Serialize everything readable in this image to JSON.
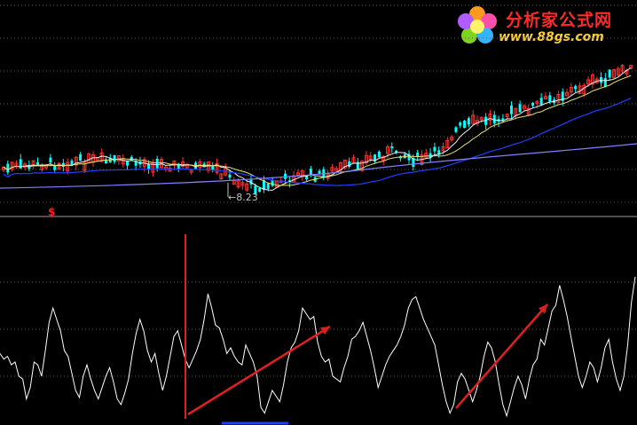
{
  "logo": {
    "title": "分析家公式网",
    "url": "www.88gs.com"
  },
  "chart_data": [
    {
      "type": "candlestick",
      "panel": "price",
      "annotations": [
        {
          "text": "$",
          "color": "#ff2020"
        },
        {
          "text": "←8.23",
          "value": 8.23,
          "color": "#c0c0c0"
        }
      ],
      "series_shown": [
        "candlesticks",
        "moving-average-yellow",
        "moving-average-white",
        "moving-average-blue",
        "moving-average-light-blue"
      ],
      "colors": {
        "up": "#ff3030",
        "down": "#00ffff",
        "ma_yellow": "#e8e070",
        "ma_white": "#f0f0f0",
        "ma_blue": "#2040ff",
        "ma_lightblue": "#8080ff"
      },
      "grid": true
    },
    {
      "type": "line",
      "panel": "indicator",
      "color": "#ffffff",
      "relative_values": [
        0.46,
        0.42,
        0.44,
        0.38,
        0.4,
        0.3,
        0.28,
        0.14,
        0.22,
        0.4,
        0.38,
        0.3,
        0.48,
        0.68,
        0.78,
        0.7,
        0.62,
        0.48,
        0.44,
        0.32,
        0.2,
        0.15,
        0.3,
        0.38,
        0.28,
        0.2,
        0.14,
        0.22,
        0.3,
        0.36,
        0.26,
        0.14,
        0.1,
        0.18,
        0.28,
        0.46,
        0.6,
        0.7,
        0.62,
        0.48,
        0.4,
        0.46,
        0.32,
        0.2,
        0.3,
        0.44,
        0.58,
        0.62,
        0.52,
        0.42,
        0.36,
        0.42,
        0.48,
        0.56,
        0.7,
        0.88,
        0.78,
        0.66,
        0.64,
        0.56,
        0.46,
        0.5,
        0.44,
        0.4,
        0.38,
        0.52,
        0.46,
        0.4,
        0.3,
        0.08,
        0.04,
        0.12,
        0.2,
        0.16,
        0.12,
        0.24,
        0.4,
        0.5,
        0.54,
        0.62,
        0.78,
        0.74,
        0.7,
        0.72,
        0.54,
        0.44,
        0.4,
        0.42,
        0.3,
        0.28,
        0.26,
        0.36,
        0.44,
        0.56,
        0.58,
        0.62,
        0.68,
        0.58,
        0.48,
        0.36,
        0.22,
        0.3,
        0.38,
        0.44,
        0.48,
        0.52,
        0.58,
        0.66,
        0.78,
        0.84,
        0.86,
        0.78,
        0.7,
        0.64,
        0.58,
        0.52,
        0.38,
        0.24,
        0.12,
        0.04,
        0.1,
        0.26,
        0.32,
        0.28,
        0.2,
        0.12,
        0.2,
        0.3,
        0.44,
        0.54,
        0.5,
        0.4,
        0.24,
        0.1,
        0.02,
        0.12,
        0.22,
        0.3,
        0.24,
        0.14,
        0.28,
        0.38,
        0.42,
        0.56,
        0.52,
        0.64,
        0.76,
        0.8,
        0.94,
        0.84,
        0.72,
        0.58,
        0.44,
        0.3,
        0.22,
        0.3,
        0.4,
        0.36,
        0.26,
        0.36,
        0.5,
        0.56,
        0.4,
        0.28,
        0.2,
        0.3,
        0.52,
        0.82,
        1.0
      ],
      "arrows": [
        "up-trend",
        "up-trend",
        "up-trend"
      ],
      "arrow_color": "#e02020",
      "grid": true
    }
  ]
}
